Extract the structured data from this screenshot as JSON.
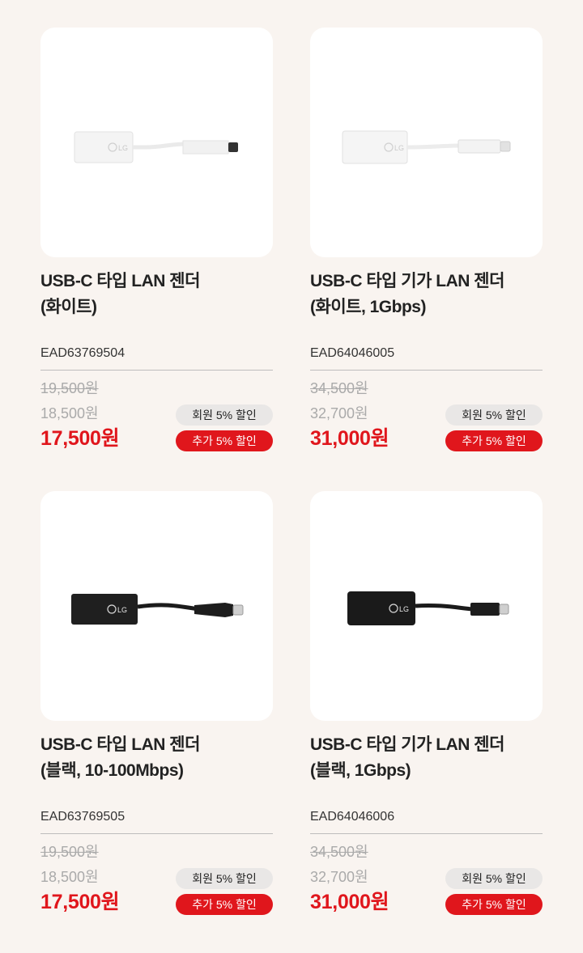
{
  "colors": {
    "background": "#f9f4f0",
    "card": "#ffffff",
    "accent_red": "#e0161c",
    "member_badge": "#e9e7e6"
  },
  "products": [
    {
      "title_line1": "USB-C 타입 LAN 젠더",
      "title_line2": "(화이트)",
      "code": "EAD63769504",
      "original_price": "19,500원",
      "member_price": "18,500원",
      "final_price": "17,500원",
      "member_badge": "회원 5% 할인",
      "extra_badge": "추가 5% 할인",
      "image": "white-usb-c-lan-adapter",
      "logo_text": "LG"
    },
    {
      "title_line1": "USB-C 타입 기가 LAN 젠더",
      "title_line2": "(화이트, 1Gbps)",
      "code": "EAD64046005",
      "original_price": "34,500원",
      "member_price": "32,700원",
      "final_price": "31,000원",
      "member_badge": "회원 5% 할인",
      "extra_badge": "추가 5% 할인",
      "image": "white-usb-c-giga-lan-adapter",
      "logo_text": "LG"
    },
    {
      "title_line1": "USB-C 타입 LAN 젠더",
      "title_line2": "(블랙, 10-100Mbps)",
      "code": "EAD63769505",
      "original_price": "19,500원",
      "member_price": "18,500원",
      "final_price": "17,500원",
      "member_badge": "회원 5% 할인",
      "extra_badge": "추가 5% 할인",
      "image": "black-usb-c-lan-adapter",
      "logo_text": "LG"
    },
    {
      "title_line1": "USB-C 타입 기가 LAN 젠더",
      "title_line2": "(블랙, 1Gbps)",
      "code": "EAD64046006",
      "original_price": "34,500원",
      "member_price": "32,700원",
      "final_price": "31,000원",
      "member_badge": "회원 5% 할인",
      "extra_badge": "추가 5% 할인",
      "image": "black-usb-c-giga-lan-adapter",
      "logo_text": "LG"
    }
  ]
}
